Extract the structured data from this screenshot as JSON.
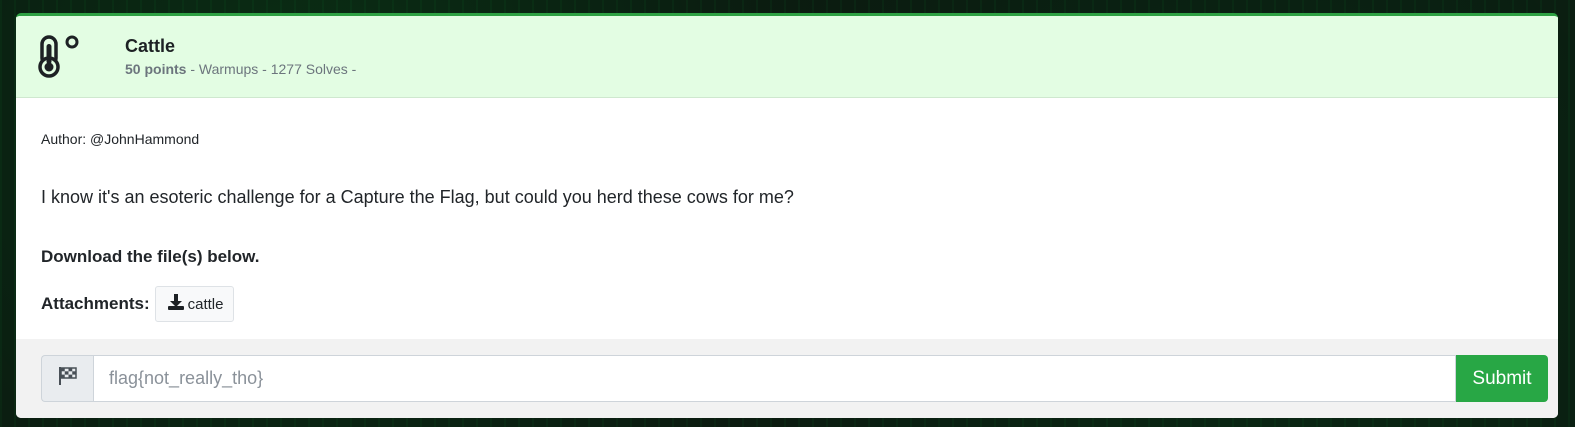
{
  "challenge": {
    "icon": "thermometer-degree-icon",
    "title": "Cattle",
    "points": "50 points",
    "meta_rest": " - Warmups - 1277 Solves -",
    "author": "Author: @JohnHammond",
    "description": "I know it's an esoteric challenge for a Capture the Flag, but could you herd these cows for me?",
    "download_note": "Download the file(s) below.",
    "attachments_label": "Attachments:",
    "attachment_file": "cattle"
  },
  "flag_form": {
    "icon": "checkered-flag-icon",
    "placeholder": "flag{not_really_tho}",
    "submit_label": "Submit"
  },
  "colors": {
    "header_bg": "#e3fde3",
    "accent_green": "#28a745"
  }
}
